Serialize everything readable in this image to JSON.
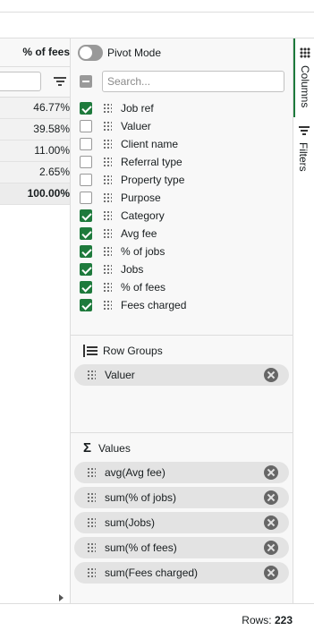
{
  "grid": {
    "column_header": "% of fees",
    "rows": [
      "46.77%",
      "39.58%",
      "11.00%",
      "2.65%"
    ],
    "total": "100.00%"
  },
  "tool_panel": {
    "pivot_mode_label": "Pivot Mode",
    "pivot_mode_on": false,
    "search_placeholder": "Search...",
    "columns": [
      {
        "label": "Job ref",
        "checked": true
      },
      {
        "label": "Valuer",
        "checked": false
      },
      {
        "label": "Client name",
        "checked": false
      },
      {
        "label": "Referral type",
        "checked": false
      },
      {
        "label": "Property type",
        "checked": false
      },
      {
        "label": "Purpose",
        "checked": false
      },
      {
        "label": "Category",
        "checked": true
      },
      {
        "label": "Avg fee",
        "checked": true
      },
      {
        "label": "% of jobs",
        "checked": true
      },
      {
        "label": "Jobs",
        "checked": true
      },
      {
        "label": "% of fees",
        "checked": true
      },
      {
        "label": "Fees charged",
        "checked": true
      }
    ],
    "row_groups": {
      "title": "Row Groups",
      "items": [
        "Valuer"
      ]
    },
    "values": {
      "title": "Values",
      "items": [
        "avg(Avg fee)",
        "sum(% of jobs)",
        "sum(Jobs)",
        "sum(% of fees)",
        "sum(Fees charged)"
      ]
    }
  },
  "side_bar": {
    "columns_tab": "Columns",
    "filters_tab": "Filters"
  },
  "status_bar": {
    "rows_label": "Rows:",
    "rows_count": "223"
  },
  "colors": {
    "accent": "#1e7a3c",
    "panel_bg": "#f8f8f8",
    "pill_bg": "#e3e3e3"
  }
}
